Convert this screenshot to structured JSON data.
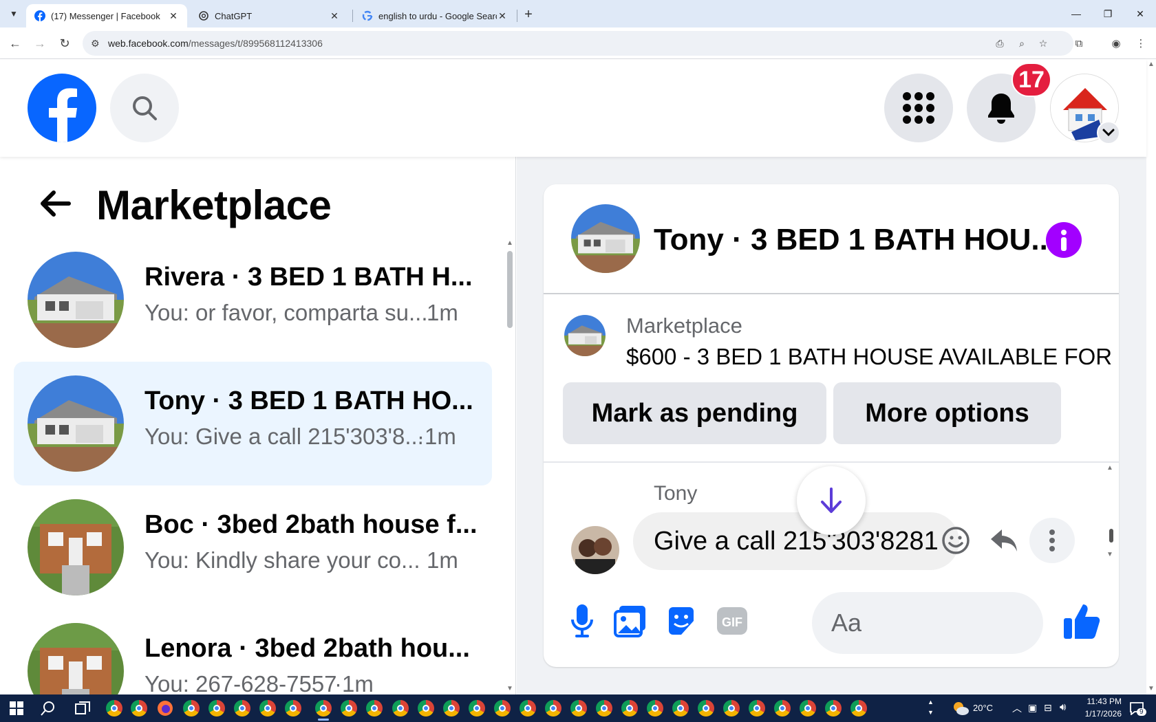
{
  "browser": {
    "tabs": [
      {
        "title": "(17) Messenger | Facebook",
        "active": true
      },
      {
        "title": "ChatGPT",
        "active": false
      },
      {
        "title": "english to urdu - Google Search",
        "active": false
      }
    ],
    "url_host": "web.facebook.com",
    "url_path": "/messages/t/899568112413306"
  },
  "header": {
    "notification_count": "17",
    "colors": {
      "brand": "#0866ff",
      "badge": "#e41e3f"
    }
  },
  "left_pane": {
    "title": "Marketplace",
    "conversations": [
      {
        "name": "Rivera · 3 BED 1 BATH H...",
        "preview": "You: or favor, comparta su...",
        "time": "1m",
        "selected": false
      },
      {
        "name": "Tony · 3 BED 1 BATH HO...",
        "preview": "You: Give a call 215'303'8...",
        "time": "·1m",
        "selected": true
      },
      {
        "name": "Boc · 3bed 2bath house f...",
        "preview": "You: Kindly share your co...",
        "time": "1m",
        "selected": false
      },
      {
        "name": "Lenora · 3bed 2bath hou...",
        "preview": "You: 267-628-7557",
        "time": "·1m",
        "selected": false
      }
    ]
  },
  "chat": {
    "title": "Tony · 3 BED 1 BATH HOU...",
    "listing": {
      "label": "Marketplace",
      "price_title": "$600 - 3 BED 1 BATH HOUSE AVAILABLE FOR ...",
      "mark_pending": "Mark as pending",
      "more_options": "More options"
    },
    "messages": [
      {
        "sender": "Tony",
        "text": "Give a call 215'303'8281"
      }
    ],
    "composer": {
      "placeholder": "Aa"
    },
    "colors": {
      "accent": "#0866ff",
      "info": "#a200ff"
    }
  },
  "taskbar": {
    "weather": "20°C",
    "time": "11:43 PM",
    "date": "1/17/2026",
    "notifications": "9"
  }
}
